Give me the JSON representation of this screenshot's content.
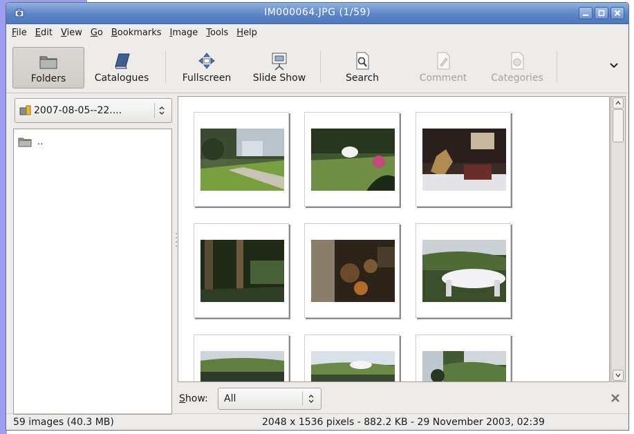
{
  "window": {
    "title": "IM000064.JPG  (1/59)"
  },
  "menubar": {
    "items": [
      {
        "label_u": "F",
        "label_rest": "ile"
      },
      {
        "label_u": "E",
        "label_rest": "dit"
      },
      {
        "label_u": "V",
        "label_rest": "iew"
      },
      {
        "label_u": "G",
        "label_rest": "o"
      },
      {
        "label_u": "B",
        "label_rest": "ookmarks"
      },
      {
        "label_u": "I",
        "label_rest": "mage"
      },
      {
        "label_u": "T",
        "label_rest": "ools"
      },
      {
        "label_u": "H",
        "label_rest": "elp"
      }
    ]
  },
  "toolbar": {
    "folders": "Folders",
    "catalogues": "Catalogues",
    "fullscreen": "Fullscreen",
    "slideshow": "Slide Show",
    "search": "Search",
    "comment": "Comment",
    "categories": "Categories"
  },
  "sidebar": {
    "folder": "2007-08-05--22....",
    "entries": [
      ".."
    ]
  },
  "filter": {
    "label_u": "S",
    "label_rest": "how:",
    "value": "All"
  },
  "status": {
    "left": "59 images (40.3 MB)",
    "right": "2048 x 1536 pixels - 882.2 KB - 29 November 2003, 02:39"
  },
  "colors": {
    "titlebar": "#5b85c6",
    "window_bg": "#edeceb",
    "desktop": "#9b9ef3"
  }
}
